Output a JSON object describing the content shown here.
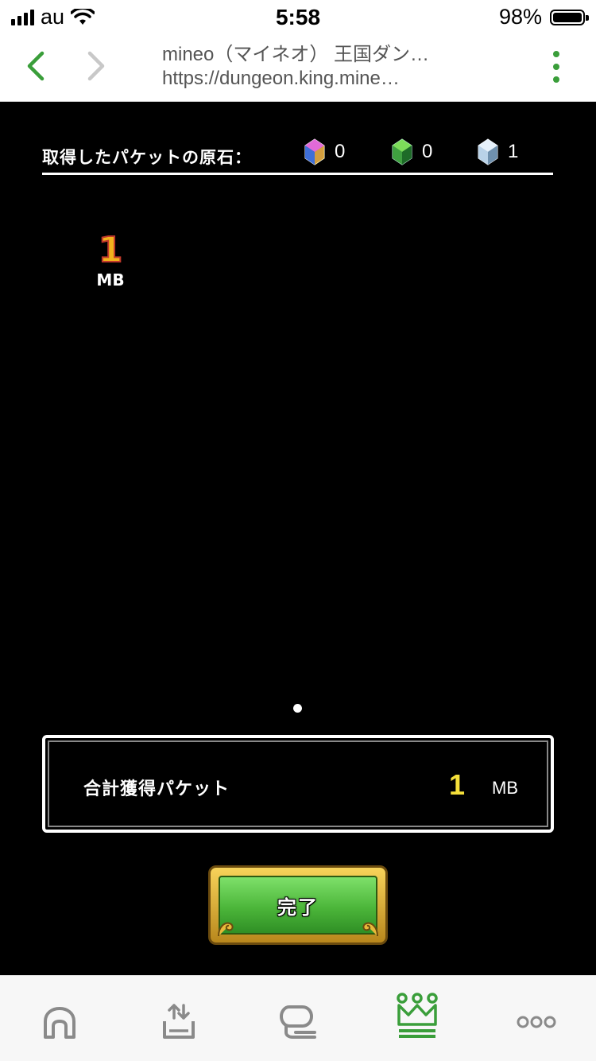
{
  "status_bar": {
    "carrier": "au",
    "time": "5:58",
    "battery": "98%"
  },
  "browser": {
    "page_title": "mineo（マイネオ） 王国ダン…",
    "url": "https://dungeon.king.mine…"
  },
  "gems": {
    "label": "取得したパケットの原石：",
    "items": [
      {
        "icon": "purple-gem-icon",
        "count": "0",
        "color": "#9b59d0"
      },
      {
        "icon": "green-gem-icon",
        "count": "0",
        "color": "#4caf50"
      },
      {
        "icon": "ice-gem-icon",
        "count": "1",
        "color": "#b8d4ea"
      }
    ]
  },
  "packet_item": {
    "value": "1",
    "unit": "MB"
  },
  "total": {
    "label": "合計獲得パケット",
    "value": "1",
    "unit": "MB"
  },
  "done_button": {
    "label": "完了"
  },
  "tabbar": {
    "items": [
      {
        "icon": "home-icon"
      },
      {
        "icon": "share-upload-icon"
      },
      {
        "icon": "chat-icon"
      },
      {
        "icon": "crown-icon",
        "active": true,
        "color": "#3a9e3a"
      },
      {
        "icon": "more-icon"
      }
    ]
  }
}
